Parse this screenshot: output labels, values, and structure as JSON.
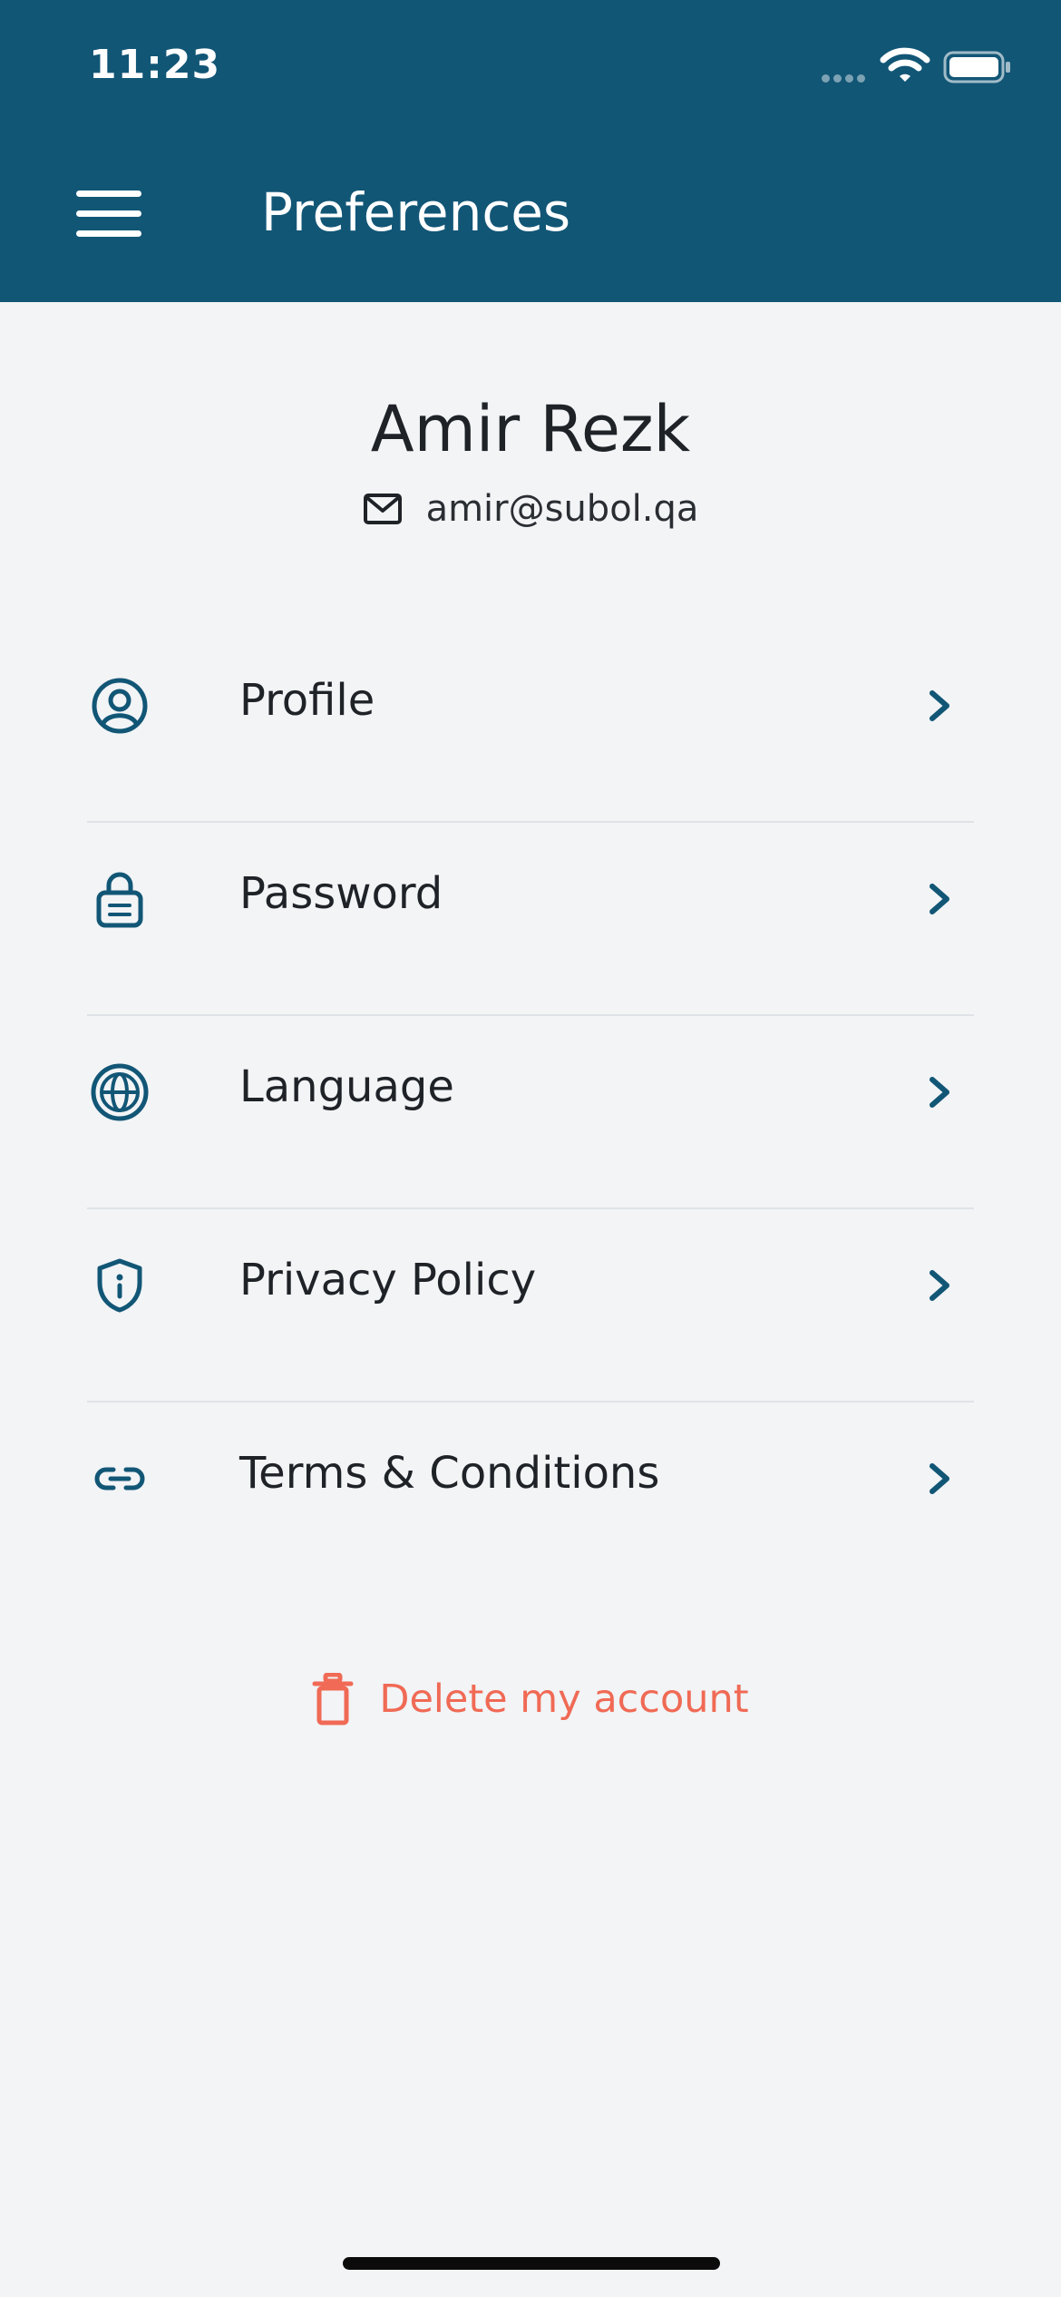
{
  "status_bar": {
    "time": "11:23"
  },
  "header": {
    "title": "Preferences"
  },
  "profile": {
    "name": "Amir Rezk",
    "email": "amir@subol.qa"
  },
  "menu": {
    "items": [
      {
        "label": "Profile",
        "icon": "user-circle-icon"
      },
      {
        "label": "Password",
        "icon": "lock-icon"
      },
      {
        "label": "Language",
        "icon": "globe-icon"
      },
      {
        "label": "Privacy Policy",
        "icon": "shield-info-icon"
      },
      {
        "label": "Terms & Conditions",
        "icon": "link-icon"
      }
    ]
  },
  "actions": {
    "delete_label": "Delete my account"
  },
  "colors": {
    "header_bg": "#125676",
    "accent": "#125676",
    "danger": "#f06a55",
    "background": "#f2f4f6"
  }
}
